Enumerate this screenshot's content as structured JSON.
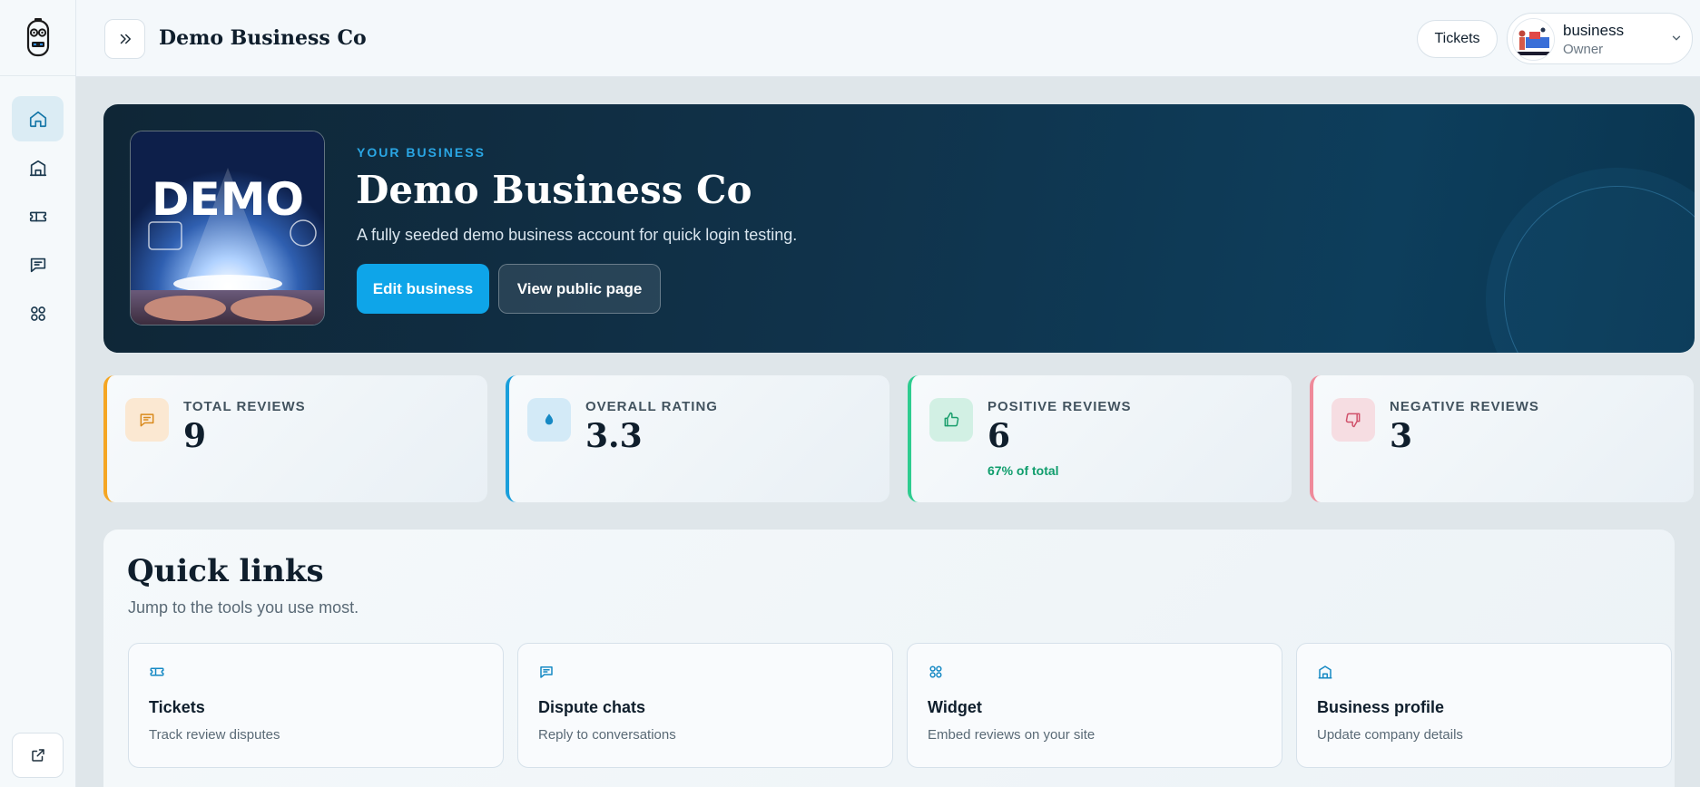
{
  "header": {
    "title": "Demo Business Co",
    "tickets_label": "Tickets",
    "user_name": "business",
    "user_role": "Owner"
  },
  "sidebar": {
    "items": [
      {
        "icon": "home-icon",
        "active": true
      },
      {
        "icon": "building-icon",
        "active": false
      },
      {
        "icon": "ticket-icon",
        "active": false
      },
      {
        "icon": "chat-icon",
        "active": false
      },
      {
        "icon": "widget-grid-icon",
        "active": false
      }
    ],
    "footer_icon": "external-link-icon"
  },
  "hero": {
    "eyebrow": "YOUR BUSINESS",
    "title": "Demo Business Co",
    "description": "A fully seeded demo business account for quick login testing.",
    "image_text": "DEMO",
    "edit_label": "Edit business",
    "public_label": "View public page"
  },
  "stats": [
    {
      "label": "TOTAL REVIEWS",
      "value": "9",
      "sub": "",
      "accent": "#f5a623",
      "icon": "chat-icon"
    },
    {
      "label": "OVERALL RATING",
      "value": "3.3",
      "sub": "",
      "accent": "#1a9fdb",
      "icon": "drop-icon"
    },
    {
      "label": "POSITIVE REVIEWS",
      "value": "6",
      "sub": "67% of total",
      "accent": "#2ecc8f",
      "icon": "thumbs-up-icon"
    },
    {
      "label": "NEGATIVE REVIEWS",
      "value": "3",
      "sub": "",
      "accent": "#ef8a9a",
      "icon": "thumbs-down-icon"
    }
  ],
  "quick_links": {
    "title": "Quick links",
    "subtitle": "Jump to the tools you use most.",
    "items": [
      {
        "title": "Tickets",
        "desc": "Track review disputes",
        "icon": "ticket-icon"
      },
      {
        "title": "Dispute chats",
        "desc": "Reply to conversations",
        "icon": "chat-icon"
      },
      {
        "title": "Widget",
        "desc": "Embed reviews on your site",
        "icon": "widget-grid-icon"
      },
      {
        "title": "Business profile",
        "desc": "Update company details",
        "icon": "building-icon"
      }
    ]
  },
  "colors": {
    "accent": "#0ea5e9",
    "hero_bg": "#0f2636",
    "positive": "#0f9d6c"
  }
}
